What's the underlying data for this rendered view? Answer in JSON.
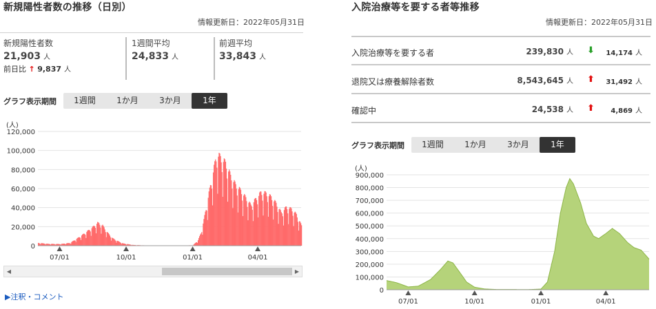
{
  "left_panel": {
    "title": "新規陽性者数の推移（日別）",
    "updated": "情報更新日：2022年05月31日",
    "stats": {
      "new_cases_label": "新規陽性者数",
      "new_cases_value": "21,903",
      "unit": "人",
      "change_label": "前日比",
      "change_arrow": "↑",
      "change_value": "9,837",
      "weekly_avg_label": "1週間平均",
      "weekly_avg_value": "24,833",
      "prev_week_label": "前週平均",
      "prev_week_value": "33,843"
    },
    "period_label": "グラフ表示期間",
    "period_options": [
      "1週間",
      "1か月",
      "3か月",
      "1年"
    ],
    "active_period": "1年",
    "notes_link": "▶注釈・コメント"
  },
  "right_panel": {
    "title": "入院治療等を要する者等推移",
    "updated": "情報更新日：2022年05月31日",
    "rows": [
      {
        "label": "入院治療等を要する者",
        "value": "239,830",
        "unit": "人",
        "direction": "down",
        "arrow": "⬇",
        "change": "14,174"
      },
      {
        "label": "退院又は療養解除者数",
        "value": "8,543,645",
        "unit": "人",
        "direction": "up",
        "arrow": "⬆",
        "change": "31,492"
      },
      {
        "label": "確認中",
        "value": "24,538",
        "unit": "人",
        "direction": "up",
        "arrow": "⬆",
        "change": "4,869"
      }
    ],
    "period_label": "グラフ表示期間",
    "period_options": [
      "1週間",
      "1か月",
      "3か月",
      "1年"
    ],
    "active_period": "1年"
  },
  "colors": {
    "cases_fill": "#ff6b6b",
    "cases_stroke": "#e03c3c",
    "hosp_fill": "#b5d37a",
    "hosp_stroke": "#8db548",
    "up_arrow": "#e31212",
    "down_arrow": "#2aa02a"
  },
  "chart_data": [
    {
      "type": "bar",
      "unit_label": "(人)",
      "ylim": [
        0,
        120000
      ],
      "yticks": [
        0,
        20000,
        40000,
        60000,
        80000,
        100000,
        120000
      ],
      "ytick_labels": [
        "0",
        "20,000",
        "40,000",
        "60,000",
        "80,000",
        "100,000",
        "120,000"
      ],
      "x_start": "2021-06-01",
      "x_end": "2022-05-31",
      "xticks": [
        {
          "date": "2021-07-01",
          "label": "07/01"
        },
        {
          "date": "2021-10-01",
          "label": "10/01"
        },
        {
          "date": "2022-01-01",
          "label": "01/01"
        },
        {
          "date": "2022-04-01",
          "label": "04/01"
        }
      ],
      "grid": true,
      "series": [
        {
          "points": [
            [
              "2021-06-01",
              3000
            ],
            [
              "2021-06-15",
              2000
            ],
            [
              "2021-07-01",
              1800
            ],
            [
              "2021-07-15",
              3000
            ],
            [
              "2021-07-25",
              8000
            ],
            [
              "2021-08-05",
              14000
            ],
            [
              "2021-08-15",
              20000
            ],
            [
              "2021-08-22",
              25000
            ],
            [
              "2021-08-29",
              22000
            ],
            [
              "2021-09-05",
              14000
            ],
            [
              "2021-09-12",
              8000
            ],
            [
              "2021-09-19",
              5000
            ],
            [
              "2021-09-26",
              2500
            ],
            [
              "2021-10-10",
              800
            ],
            [
              "2021-11-01",
              200
            ],
            [
              "2021-12-15",
              200
            ],
            [
              "2022-01-01",
              500
            ],
            [
              "2022-01-08",
              6000
            ],
            [
              "2022-01-12",
              14000
            ],
            [
              "2022-01-16",
              28000
            ],
            [
              "2022-01-20",
              45000
            ],
            [
              "2022-01-25",
              65000
            ],
            [
              "2022-01-30",
              85000
            ],
            [
              "2022-02-03",
              100000
            ],
            [
              "2022-02-08",
              96000
            ],
            [
              "2022-02-15",
              90000
            ],
            [
              "2022-02-22",
              76000
            ],
            [
              "2022-03-01",
              66000
            ],
            [
              "2022-03-08",
              60000
            ],
            [
              "2022-03-15",
              52000
            ],
            [
              "2022-03-22",
              44000
            ],
            [
              "2022-03-29",
              51000
            ],
            [
              "2022-04-05",
              58000
            ],
            [
              "2022-04-12",
              57000
            ],
            [
              "2022-04-19",
              53000
            ],
            [
              "2022-04-26",
              46000
            ],
            [
              "2022-05-03",
              36000
            ],
            [
              "2022-05-10",
              42000
            ],
            [
              "2022-05-17",
              40000
            ],
            [
              "2022-05-24",
              34000
            ],
            [
              "2022-05-31",
              21903
            ]
          ]
        }
      ]
    },
    {
      "type": "area",
      "unit_label": "(人)",
      "ylim": [
        0,
        900000
      ],
      "yticks": [
        0,
        100000,
        200000,
        300000,
        400000,
        500000,
        600000,
        700000,
        800000,
        900000
      ],
      "ytick_labels": [
        "0",
        "100,000",
        "200,000",
        "300,000",
        "400,000",
        "500,000",
        "600,000",
        "700,000",
        "800,000",
        "900,000"
      ],
      "x_start": "2021-06-01",
      "x_end": "2022-05-31",
      "xticks": [
        {
          "date": "2021-07-01",
          "label": "07/01"
        },
        {
          "date": "2021-10-01",
          "label": "10/01"
        },
        {
          "date": "2022-01-01",
          "label": "01/01"
        },
        {
          "date": "2022-04-01",
          "label": "04/01"
        }
      ],
      "grid": true,
      "series": [
        {
          "points": [
            [
              "2021-06-01",
              72000
            ],
            [
              "2021-06-15",
              55000
            ],
            [
              "2021-07-01",
              22000
            ],
            [
              "2021-07-15",
              28000
            ],
            [
              "2021-08-01",
              80000
            ],
            [
              "2021-08-15",
              160000
            ],
            [
              "2021-08-25",
              225000
            ],
            [
              "2021-09-01",
              210000
            ],
            [
              "2021-09-10",
              140000
            ],
            [
              "2021-09-20",
              60000
            ],
            [
              "2021-10-01",
              20000
            ],
            [
              "2021-10-15",
              6000
            ],
            [
              "2021-11-01",
              2000
            ],
            [
              "2021-12-15",
              1500
            ],
            [
              "2022-01-01",
              5000
            ],
            [
              "2022-01-10",
              60000
            ],
            [
              "2022-01-20",
              300000
            ],
            [
              "2022-01-28",
              600000
            ],
            [
              "2022-02-05",
              800000
            ],
            [
              "2022-02-10",
              870000
            ],
            [
              "2022-02-15",
              830000
            ],
            [
              "2022-02-25",
              680000
            ],
            [
              "2022-03-05",
              520000
            ],
            [
              "2022-03-15",
              420000
            ],
            [
              "2022-03-22",
              400000
            ],
            [
              "2022-04-01",
              440000
            ],
            [
              "2022-04-10",
              480000
            ],
            [
              "2022-04-20",
              440000
            ],
            [
              "2022-05-01",
              370000
            ],
            [
              "2022-05-10",
              330000
            ],
            [
              "2022-05-20",
              310000
            ],
            [
              "2022-05-31",
              239830
            ]
          ]
        }
      ]
    }
  ]
}
